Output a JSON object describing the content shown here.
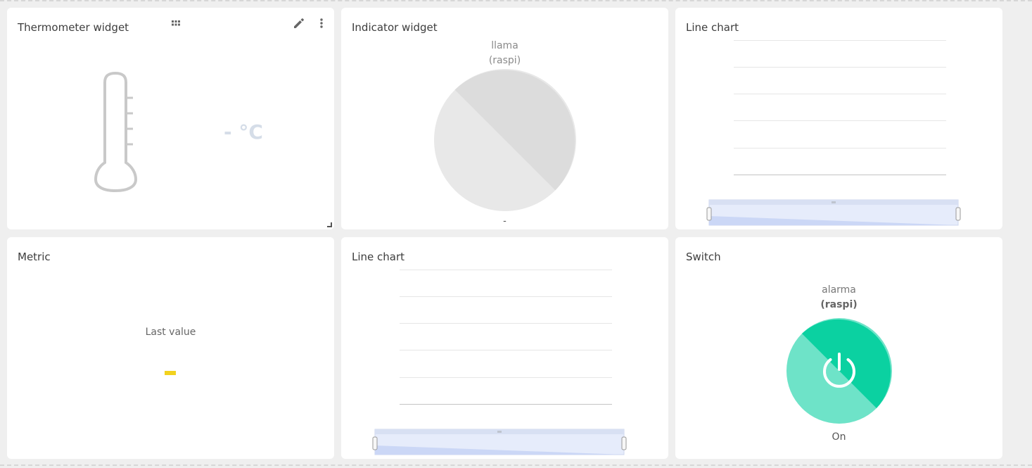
{
  "widgets": {
    "thermometer": {
      "title": "Thermometer widget",
      "value": "- °C"
    },
    "indicator": {
      "title": "Indicator widget",
      "label": "llama",
      "device": "(raspi)",
      "value": "-"
    },
    "line_chart_1": {
      "title": "Line chart"
    },
    "metric": {
      "title": "Metric",
      "label": "Last value",
      "value_color": "#f2d21e"
    },
    "line_chart_2": {
      "title": "Line chart"
    },
    "switch": {
      "title": "Switch",
      "label": "alarma",
      "device": "(raspi)",
      "state": "On",
      "color": "#0bd1a1"
    }
  },
  "toolbar_icons": [
    "drag-grid-icon",
    "edit-pencil-icon",
    "more-vertical-icon"
  ],
  "colors": {
    "thermometer_value": "#d5dde8",
    "indicator_off": "#dedede",
    "switch_on": "#0bd1a1",
    "navigator_fill": "#e6ecfb"
  }
}
